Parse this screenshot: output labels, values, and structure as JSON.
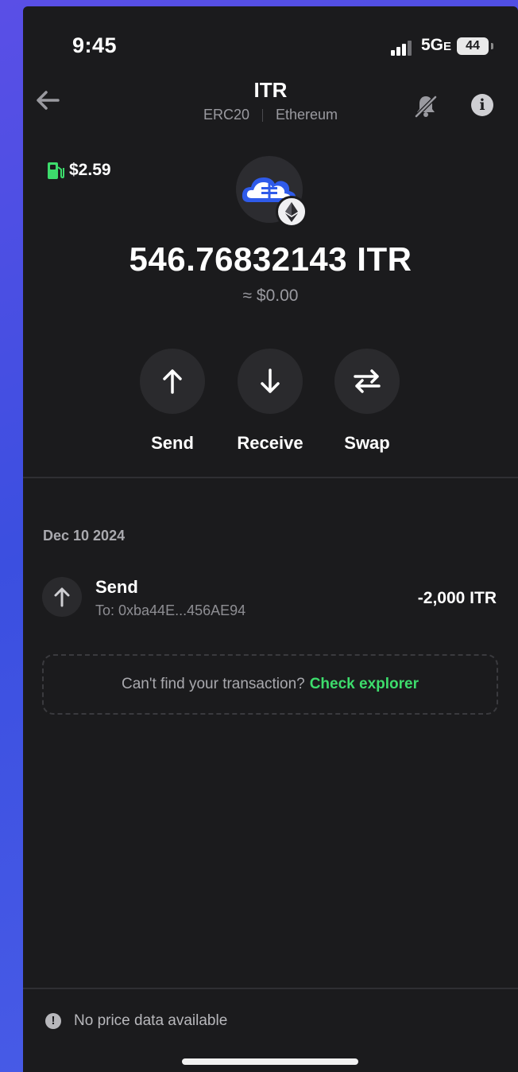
{
  "status_bar": {
    "time": "9:45",
    "network": "5G",
    "network_suffix": "E",
    "battery": "44"
  },
  "header": {
    "title": "ITR",
    "standard": "ERC20",
    "network": "Ethereum",
    "bell_icon": "bell-slash-icon",
    "info_icon": "info-icon"
  },
  "gas": {
    "amount": "$2.59",
    "icon": "gas-pump-icon",
    "color": "#3ddc6c"
  },
  "token": {
    "logo_icon": "cloud-logo-icon",
    "badge_icon": "ethereum-icon",
    "balance": "546.76832143 ITR",
    "fiat": "≈ $0.00"
  },
  "actions": [
    {
      "label": "Send",
      "icon": "arrow-up-icon"
    },
    {
      "label": "Receive",
      "icon": "arrow-down-icon"
    },
    {
      "label": "Swap",
      "icon": "swap-arrows-icon"
    }
  ],
  "history": {
    "date": "Dec 10 2024",
    "transactions": [
      {
        "title": "Send",
        "to": "To: 0xba44E...456AE94",
        "amount": "-2,000 ITR",
        "icon": "arrow-up-icon"
      }
    ]
  },
  "explorer": {
    "question": "Can't find your transaction?",
    "link": "Check explorer",
    "link_color": "#3ddc6c"
  },
  "footer": {
    "message": "No price data available",
    "icon": "alert-icon",
    "alert_glyph": "!"
  },
  "colors": {
    "background": "#1b1b1d",
    "accent": "#3ddc6c",
    "logo_blue": "#2f5bea"
  }
}
